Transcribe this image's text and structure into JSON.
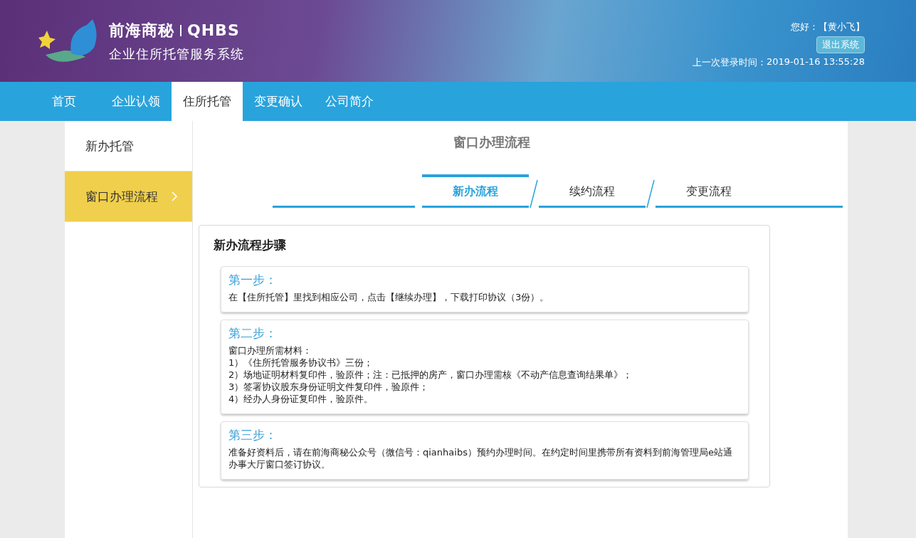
{
  "header": {
    "brand": "前海商秘",
    "brand_code": "QHBS",
    "subtitle": "企业住所托管服务系统",
    "greeting": "您好：",
    "user": "【黄小飞】",
    "logout": "退出系统",
    "last_login_label": "上一次登录时间：",
    "last_login": "2019-01-16 13:55:28"
  },
  "nav": [
    {
      "label": "首页",
      "selected": false
    },
    {
      "label": "企业认领",
      "selected": false
    },
    {
      "label": "住所托管",
      "selected": true
    },
    {
      "label": "变更确认",
      "selected": false
    },
    {
      "label": "公司简介",
      "selected": false
    }
  ],
  "sidebar": {
    "items": [
      {
        "label": "新办托管",
        "selected": false
      },
      {
        "label": "窗口办理流程",
        "selected": true
      }
    ]
  },
  "page_title": "窗口办理流程",
  "tabs": [
    {
      "label": "新办流程",
      "selected": true
    },
    {
      "label": "续约流程",
      "selected": false
    },
    {
      "label": "变更流程",
      "selected": false
    }
  ],
  "panel": {
    "title": "新办流程步骤",
    "steps": [
      {
        "title": "第一步：",
        "lines": [
          "在【住所托管】里找到相应公司，点击【继续办理】，下载打印协议（3份）。"
        ]
      },
      {
        "title": "第二步：",
        "lines": [
          "窗口办理所需材料：",
          "1）《住所托管服务协议书》三份；",
          "2）场地证明材料复印件，验原件；注：已抵押的房产，窗口办理需核《不动产信息查询结果单》；",
          "3）签署协议股东身份证明文件复印件，验原件；",
          "4）经办人身份证复印件，验原件。"
        ]
      },
      {
        "title": "第三步：",
        "lines": [
          "准备好资料后，请在前海商秘公众号（微信号：qianhaibs）预约办理时间。在约定时间里携带所有资料到前海管理局e站通办事大厅窗口签订协议。"
        ]
      }
    ]
  }
}
